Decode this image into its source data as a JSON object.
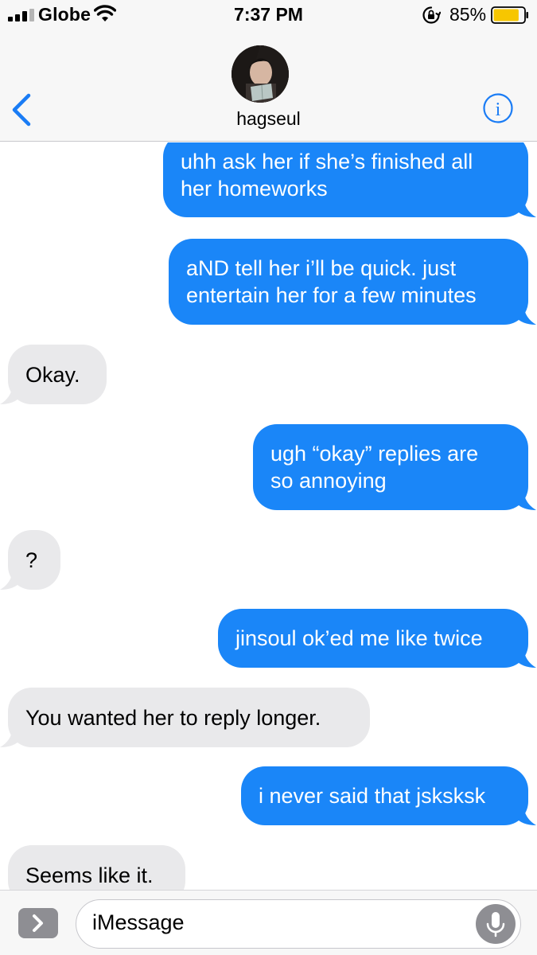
{
  "status_bar": {
    "carrier": "Globe",
    "time": "7:37 PM",
    "battery_percent": "85%",
    "battery_level": 0.85,
    "icons": [
      "signal-icon",
      "wifi-icon",
      "rotation-lock-icon",
      "battery-icon"
    ]
  },
  "header": {
    "contact_name": "hagseul",
    "back_icon": "chevron-left-icon",
    "info_icon": "info-icon"
  },
  "messages": [
    {
      "from": "me",
      "lines": [
        "uhh ask her if she’s finished all",
        "her homeworks"
      ]
    },
    {
      "from": "me",
      "lines": [
        "aND tell her i’ll be quick. just",
        "entertain her for a few minutes"
      ]
    },
    {
      "from": "them",
      "lines": [
        "Okay."
      ]
    },
    {
      "from": "me",
      "lines": [
        "ugh “okay” replies are",
        "so annoying"
      ]
    },
    {
      "from": "them",
      "lines": [
        "?"
      ]
    },
    {
      "from": "me",
      "lines": [
        "jinsoul ok’ed me like twice"
      ]
    },
    {
      "from": "them",
      "lines": [
        "You wanted her to reply longer."
      ]
    },
    {
      "from": "me",
      "lines": [
        "i never said that jsksksk"
      ]
    },
    {
      "from": "them",
      "lines": [
        "Seems like it."
      ]
    }
  ],
  "input": {
    "placeholder": "iMessage",
    "apps_icon": "chevron-right-icon",
    "mic_icon": "microphone-icon"
  },
  "colors": {
    "sent_bubble": "#1a86f8",
    "received_bubble": "#e9e9eb",
    "accent": "#1a7cf5",
    "bar_background": "#f7f7f7",
    "battery_fill": "#f7c600"
  }
}
